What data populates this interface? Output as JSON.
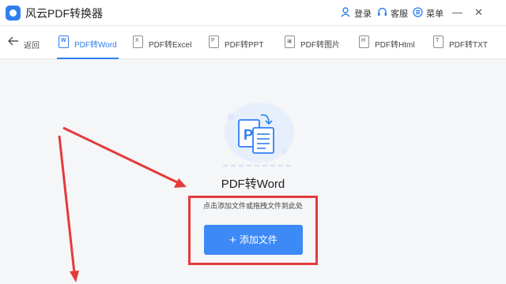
{
  "app": {
    "title": "风云PDF转换器",
    "login": "登录",
    "service": "客服",
    "menu": "菜单",
    "minimize": "—",
    "close": "✕"
  },
  "toolbar": {
    "back": "返回",
    "tabs": [
      {
        "label": "PDF转Word",
        "icon": "W",
        "active": true
      },
      {
        "label": "PDF转Excel",
        "icon": "X",
        "active": false
      },
      {
        "label": "PDF转PPT",
        "icon": "P",
        "active": false
      },
      {
        "label": "PDF转图片",
        "icon": "▣",
        "active": false
      },
      {
        "label": "PDF转Html",
        "icon": "H",
        "active": false
      },
      {
        "label": "PDF转TXT",
        "icon": "T",
        "active": false
      }
    ]
  },
  "main": {
    "heading": "PDF转Word",
    "hint": "点击添加文件或拖拽文件到此处",
    "add_button": "添加文件",
    "illustration_letter": "P"
  },
  "colors": {
    "accent": "#2f7ff0",
    "annotation": "#e43b3b"
  }
}
